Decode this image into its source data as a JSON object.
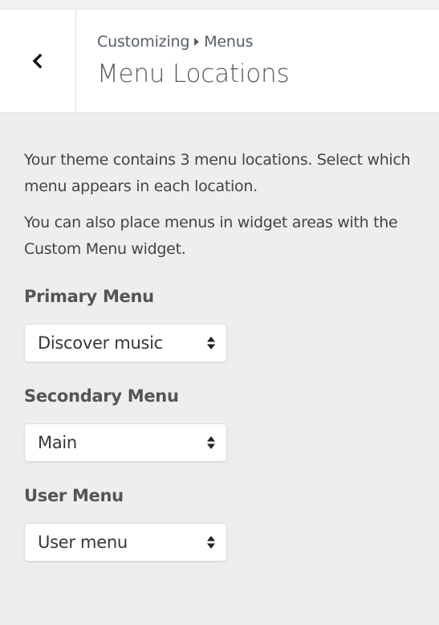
{
  "header": {
    "breadcrumb_root": "Customizing",
    "breadcrumb_current": "Menus",
    "title": "Menu Locations"
  },
  "intro": {
    "line1": "Your theme contains 3 menu locations. Select which menu appears in each location.",
    "line2": "You can also place menus in widget areas with the Custom Menu widget."
  },
  "locations": [
    {
      "label": "Primary Menu",
      "selected": "Discover music"
    },
    {
      "label": "Secondary Menu",
      "selected": "Main"
    },
    {
      "label": "User Menu",
      "selected": "User menu"
    }
  ],
  "icons": {
    "back": "chevron-left-icon",
    "breadcrumb_separator": "triangle-right-icon",
    "select_arrows": "up-down-arrows-icon"
  },
  "colors": {
    "panel_background": "#eeeeee",
    "header_background": "#ffffff",
    "text": "#444444",
    "heading_text": "#555d66"
  }
}
